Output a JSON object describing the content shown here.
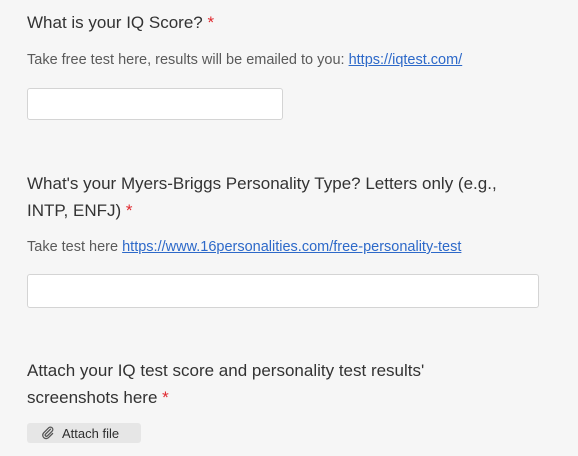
{
  "questions": [
    {
      "label": "What is your IQ Score?",
      "required_mark": "*",
      "help_text": "Take free test here, results will be emailed to you: ",
      "link_text": "https://iqtest.com/",
      "value": "",
      "placeholder": ""
    },
    {
      "label_line1": "What's your Myers-Briggs Personality Type? Letters only (e.g.,",
      "label_line2": "INTP, ENFJ)",
      "required_mark": "*",
      "help_text": "Take test here ",
      "link_text": "https://www.16personalities.com/free-personality-test",
      "value": "",
      "placeholder": ""
    },
    {
      "label_line1": "Attach your IQ test score and personality test results'",
      "label_line2": "screenshots here",
      "required_mark": "*",
      "attach_label": "Attach file",
      "attach_icon": "paperclip-icon"
    }
  ],
  "colors": {
    "background": "#f6f6f6",
    "required": "#e0282e",
    "link": "#2d69c9"
  }
}
